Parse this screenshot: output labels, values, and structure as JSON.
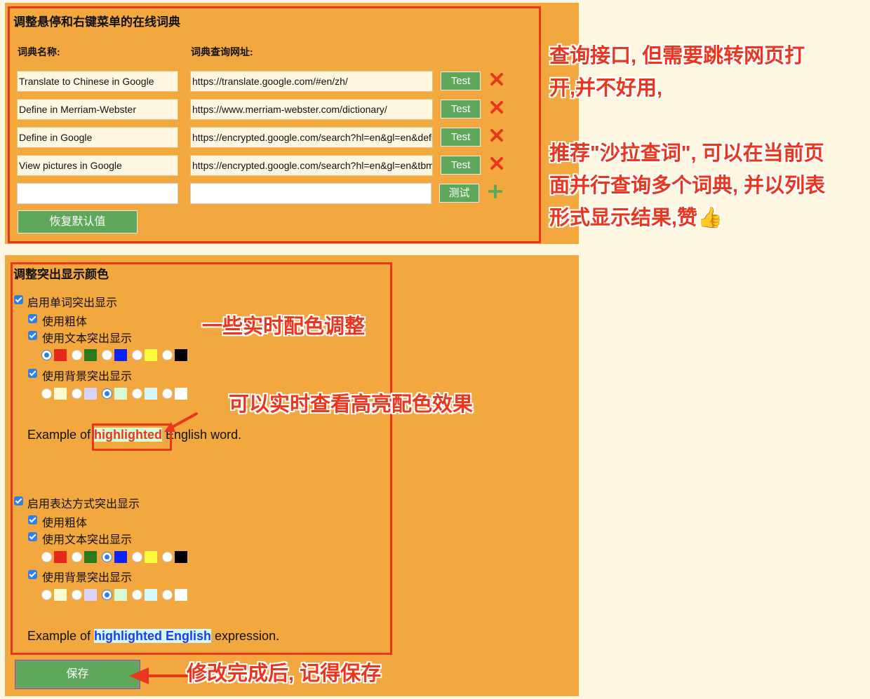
{
  "dict_section": {
    "title": "调整悬停和右键菜单的在线词典",
    "name_header": "词典名称:",
    "url_header": "词典查询网址:",
    "rows": [
      {
        "name": "Translate to Chinese in Google",
        "url": "https://translate.google.com/#en/zh/",
        "button": "Test"
      },
      {
        "name": "Define in Merriam-Webster",
        "url": "https://www.merriam-webster.com/dictionary/",
        "button": "Test"
      },
      {
        "name": "Define in Google",
        "url": "https://encrypted.google.com/search?hl=en&gl=en&define:",
        "button": "Test"
      },
      {
        "name": "View pictures in Google",
        "url": "https://encrypted.google.com/search?hl=en&gl=en&tbm=isch&q=",
        "button": "Test"
      }
    ],
    "new_row": {
      "name": "",
      "url": "",
      "button": "测试"
    },
    "restore_button": "恢复默认值"
  },
  "highlight_section": {
    "title": "调整突出显示颜色",
    "word": {
      "enable_label": "启用单词突出显示",
      "bold_label": "使用粗体",
      "text_label": "使用文本突出显示",
      "bg_label": "使用背景突出显示",
      "text_colors": [
        "#e8261c",
        "#2a7a1c",
        "#0a23f5",
        "#fffb3d",
        "#000000"
      ],
      "text_selected": 0,
      "bg_colors": [
        "#fffbd2",
        "#d9d3f7",
        "#d9fbd3",
        "#d4f7fb",
        "#ffffff"
      ],
      "bg_selected": 2,
      "example_prefix": "Example of ",
      "example_highlight": "highlighted",
      "example_suffix": " English word."
    },
    "expression": {
      "enable_label": "启用表达方式突出显示",
      "bold_label": "使用粗体",
      "text_label": "使用文本突出显示",
      "bg_label": "使用背景突出显示",
      "text_colors": [
        "#e8261c",
        "#2a7a1c",
        "#0a23f5",
        "#fffb3d",
        "#000000"
      ],
      "text_selected": 2,
      "bg_colors": [
        "#fffbd2",
        "#d9d3f7",
        "#d9fbd3",
        "#d4f7fb",
        "#ffffff"
      ],
      "bg_selected": 2,
      "example_prefix": "Example of ",
      "example_highlight": "highlighted English",
      "example_suffix": " expression."
    },
    "save_button": "保存"
  },
  "annotations": {
    "lookup_line1": "查询接口, 但需要跳转网页打",
    "lookup_line2": "开,并不好用,",
    "recommend_line1": "推荐\"沙拉查词\", 可以在当前页",
    "recommend_line2": "面并行查询多个词典, 并以列表",
    "recommend_line3": "形式显示结果,赞👍",
    "realtime_colors": "一些实时配色调整",
    "realtime_preview": "可以实时查看高亮配色效果",
    "save_reminder": "修改完成后, 记得保存"
  },
  "colors": {
    "panel": "#f3a73f",
    "page": "#fdf6e1",
    "button_green": "#5fa85b",
    "annotation_red": "#e8361f",
    "delete_red": "#e8361f",
    "add_green": "#5fa85b",
    "checkbox_blue": "#2f7fe8"
  }
}
